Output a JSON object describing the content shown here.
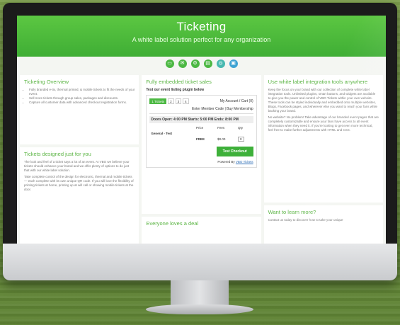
{
  "hero": {
    "title": "Ticketing",
    "subtitle": "A white label solution perfect for any organization"
  },
  "icons": [
    "ticket-icon",
    "envelope-icon",
    "gear-icon",
    "chart-icon",
    "globe-icon",
    "lock-icon"
  ],
  "colors": {
    "brand_green": "#4cb843",
    "accent_teal": "#48b9b0",
    "accent_blue": "#3fa3d3"
  },
  "left": {
    "overview_title": "Ticketing Overview",
    "overview_items": [
      "Fully branded e-tix, thermal printed, & mobile tickets to fit the needs of your event.",
      "Sell more tickets through group sales, packages and discounts.",
      "Capture all customer data with advanced checkout registration forms."
    ],
    "designed_title": "Tickets designed just for you",
    "designed_p1": "The look and feel of a ticket says a lot of an event. At VBO we believe your tickets should enhance your brand and we offer plenty of options to do just that with our white label solution.",
    "designed_p2": "Take complete control of the design for electronic, thermal and mobile tickets — each complete with its own unique QR code. If you will love the flexibility of printing tickets at home, printing up at will call or showing mobile tickets at the door."
  },
  "middle": {
    "embedded_title": "Fully embedded ticket sales",
    "plugin_caption": "Test our event listing plugin below",
    "tabs": [
      "1 Tickets",
      "2",
      "3",
      "4"
    ],
    "account": "My Account / Cart (0)",
    "member": "Enter Member Code | Buy Membership",
    "event_head": "Doors Open: 4:00 PM   Starts: 5:00 PM   Ends: 8:00 PM",
    "col_price": "Price",
    "col_fees": "Fees",
    "col_qty": "Qty",
    "ticket_name": "General - Test",
    "ticket_price": "FREE",
    "ticket_fee": "$0.00",
    "ticket_qty": "0",
    "checkout_label": "Test Checkout",
    "powered_prefix": "Powered By",
    "powered_brand": "VBO Tickets",
    "loves_title": "Everyone loves a deal"
  },
  "right": {
    "integration_title": "Use white label integration tools anywhere",
    "integration_p1": "Keep the focus on your brand with our collection of complete white label integration tools. Unlimited plugins, smart buttons, and widgets are available to give you the power and control of VBO Tickets within your own website. These tools can be styled individually and embedded onto multiple websites, Blogs, Facebook pages, and wherever else you want to reach your fans while backing your brand.",
    "integration_p2": "No website? No problem! Take advantage of our branded event pages that are completely customizable and ensure your fans have access to all event information when they need it. If you're looking to get even more technical, feel free to make further adjustments with HTML and CSS.",
    "learn_title": "Want to learn more?",
    "learn_p": "Contact us today to discover how to take your unique"
  }
}
